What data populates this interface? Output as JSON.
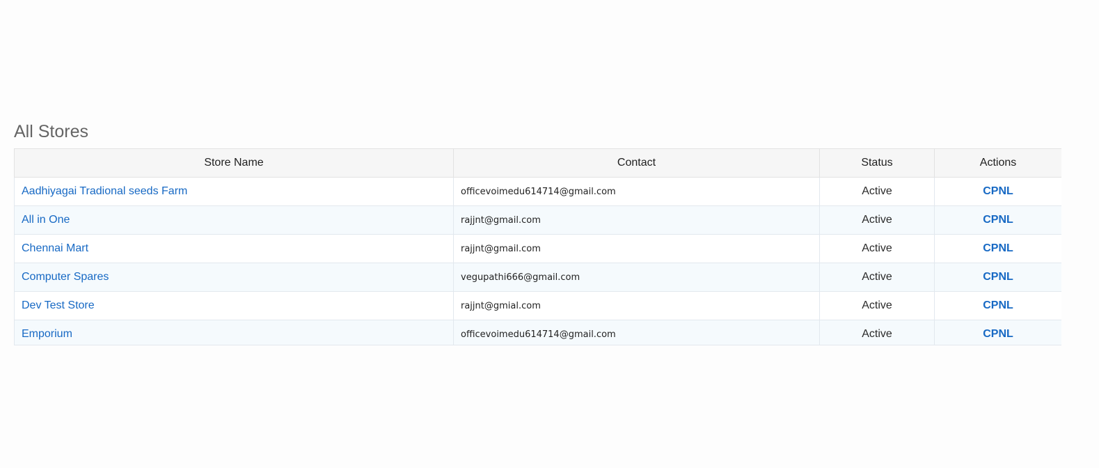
{
  "page": {
    "title": "All Stores"
  },
  "table": {
    "headers": {
      "store_name": "Store Name",
      "contact": "Contact",
      "status": "Status",
      "actions": "Actions"
    },
    "rows": [
      {
        "store_name": "Aadhiyagai Tradional seeds Farm",
        "contact": "officevoimedu614714@gmail.com",
        "status": "Active",
        "action": "CPNL"
      },
      {
        "store_name": "All in One",
        "contact": "rajjnt@gmail.com",
        "status": "Active",
        "action": "CPNL"
      },
      {
        "store_name": "Chennai Mart",
        "contact": "rajjnt@gmail.com",
        "status": "Active",
        "action": "CPNL"
      },
      {
        "store_name": "Computer Spares",
        "contact": "vegupathi666@gmail.com",
        "status": "Active",
        "action": "CPNL"
      },
      {
        "store_name": "Dev Test Store",
        "contact": "rajjnt@gmial.com",
        "status": "Active",
        "action": "CPNL"
      },
      {
        "store_name": "Emporium",
        "contact": "officevoimedu614714@gmail.com",
        "status": "Active",
        "action": "CPNL"
      }
    ]
  },
  "colors": {
    "link": "#1769c4",
    "title": "#656565",
    "header_bg": "#f6f6f6",
    "row_alt_bg": "#f5fafd"
  }
}
